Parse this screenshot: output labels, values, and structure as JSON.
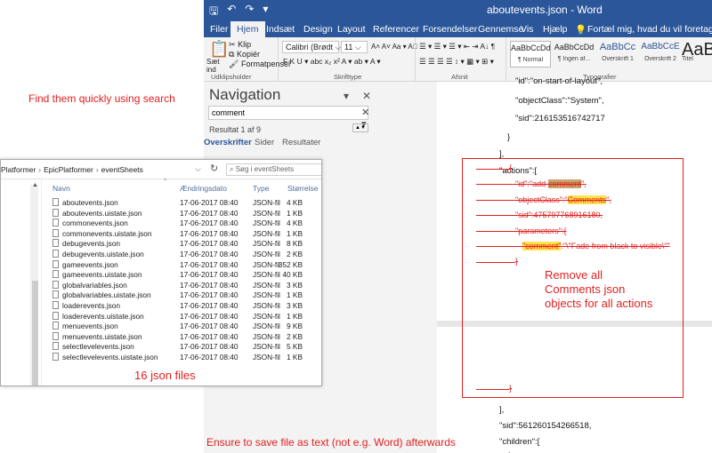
{
  "word": {
    "title": "aboutevents.json - Word",
    "qat": [
      "🖫",
      "↶",
      "↷",
      "▾"
    ],
    "tabs": [
      "Filer",
      "Hjem",
      "Indsæt",
      "Design",
      "Layout",
      "Referencer",
      "Forsendelser",
      "Gennemse",
      "Vis",
      "Hjælp",
      "Fortæl mig, hvad du vil foretage dig"
    ],
    "active_tab": "Hjem",
    "ribbon": {
      "paste_label": "Sæt ind",
      "cut": "Klip",
      "copy": "Kopiér",
      "format_painter": "Formatpensel",
      "clipboard_group": "Udklipsholder",
      "font_name": "Calibri (Brødt",
      "font_size": "11",
      "font_group": "Skrifttype",
      "paragraph_group": "Afsnit",
      "styles_group": "Typografier",
      "font_row1": "A˄  A˅   Aa ▾   A⃝",
      "font_row2": "F  K  U ▾  abc  x₂  x²   A ▾  ab ▾  A ▾",
      "para_row1": "☰ ▾  ☰ ▾  ☰ ▾   ⇤  ⇥   A↓   ¶",
      "para_row2": "☰  ☰  ☰  ☰   ↕ ▾   ▦ ▾  ⊞ ▾",
      "styles": [
        {
          "preview": "AaBbCcDd",
          "name": "¶ Normal"
        },
        {
          "preview": "AaBbCcDd",
          "name": "¶ Ingen af..."
        },
        {
          "preview": "AaBbCc",
          "name": "Overskrift 1"
        },
        {
          "preview": "AaBbCcE",
          "name": "Overskrift 2"
        },
        {
          "preview": "AaB",
          "name": "Titel"
        }
      ]
    }
  },
  "navigation": {
    "title": "Navigation",
    "search_value": "comment",
    "result": "Resultat 1 af 9",
    "tabs": [
      "Overskrifter",
      "Sider",
      "Resultater"
    ]
  },
  "document": {
    "line_top": "\"id\":\"on-start-of-layout\",",
    "line_objectclass": "\"objectClass\":\"System\",",
    "line_sid": "\"sid\":216153516742717",
    "line_brace": "}",
    "line_bracket": "],",
    "line_actions": "\"actions\":[",
    "struck_open": "{",
    "struck_id_pre": "\"id\":\"add-",
    "struck_id_hl": "comment",
    "struck_id_post": "\",",
    "struck_oc_pre": "\"objectClass\":\"",
    "struck_oc_hl": "Comments",
    "struck_oc_post": "\",",
    "struck_sid": "\"sid\":475797768916180,",
    "struck_params": "\"parameters\":{",
    "struck_comment_hl": "\"comment\"",
    "struck_comment_post": ":\"\\\"Fade from black to visible\\\"\"",
    "struck_close": "}",
    "struck_close2": "}",
    "line_bracket2": "],",
    "line_sid2": "\"sid\":561260154266518,",
    "line_children": "\"children\":[",
    "line_openbrace": "{"
  },
  "explorer": {
    "breadcrumb": [
      "Platformer",
      "EpicPlatformer",
      "eventSheets"
    ],
    "search_placeholder": "Søg i eventSheets",
    "columns": [
      "Navn",
      "Ændringsdato",
      "Type",
      "Størrelse"
    ],
    "files": [
      {
        "name": "aboutevents.json",
        "date": "17-06-2017 08:40",
        "type": "JSON-fil",
        "size": "4 KB"
      },
      {
        "name": "aboutevents.uistate.json",
        "date": "17-06-2017 08:40",
        "type": "JSON-fil",
        "size": "1 KB"
      },
      {
        "name": "commonevents.json",
        "date": "17-06-2017 08:40",
        "type": "JSON-fil",
        "size": "4 KB"
      },
      {
        "name": "commonevents.uistate.json",
        "date": "17-06-2017 08:40",
        "type": "JSON-fil",
        "size": "1 KB"
      },
      {
        "name": "debugevents.json",
        "date": "17-06-2017 08:40",
        "type": "JSON-fil",
        "size": "8 KB"
      },
      {
        "name": "debugevents.uistate.json",
        "date": "17-06-2017 08:40",
        "type": "JSON-fil",
        "size": "2 KB"
      },
      {
        "name": "gameevents.json",
        "date": "17-06-2017 08:40",
        "type": "JSON-fil",
        "size": "352 KB"
      },
      {
        "name": "gameevents.uistate.json",
        "date": "17-06-2017 08:40",
        "type": "JSON-fil",
        "size": "40 KB"
      },
      {
        "name": "globalvariables.json",
        "date": "17-06-2017 08:40",
        "type": "JSON-fil",
        "size": "3 KB"
      },
      {
        "name": "globalvariables.uistate.json",
        "date": "17-06-2017 08:40",
        "type": "JSON-fil",
        "size": "1 KB"
      },
      {
        "name": "loaderevents.json",
        "date": "17-06-2017 08:40",
        "type": "JSON-fil",
        "size": "3 KB"
      },
      {
        "name": "loaderevents.uistate.json",
        "date": "17-06-2017 08:40",
        "type": "JSON-fil",
        "size": "1 KB"
      },
      {
        "name": "menuevents.json",
        "date": "17-06-2017 08:40",
        "type": "JSON-fil",
        "size": "9 KB"
      },
      {
        "name": "menuevents.uistate.json",
        "date": "17-06-2017 08:40",
        "type": "JSON-fil",
        "size": "2 KB"
      },
      {
        "name": "selectlevelevents.json",
        "date": "17-06-2017 08:40",
        "type": "JSON-fil",
        "size": "5 KB"
      },
      {
        "name": "selectlevelevents.uistate.json",
        "date": "17-06-2017 08:40",
        "type": "JSON-fil",
        "size": "1 KB"
      }
    ]
  },
  "annotations": {
    "find": "Find them quickly using search",
    "files_count": "16 json files",
    "remove": [
      "Remove all",
      "Comments json",
      "objects for all actions"
    ],
    "save": "Ensure to save file as text (not e.g. Word) afterwards"
  },
  "colors": {
    "word_blue": "#2b579a",
    "annotation_red": "#e02020",
    "highlight_yellow": "#ffe14a"
  }
}
